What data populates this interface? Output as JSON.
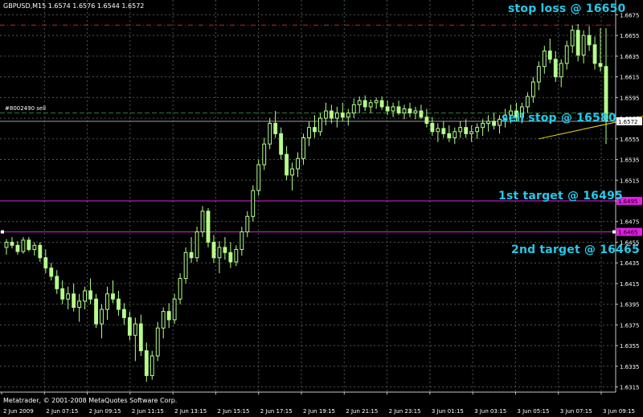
{
  "window": {
    "header": "GBPUSD,M15  1.6574 1.6576 1.6544 1.6572",
    "copyright": "Metatrader, © 2001-2008 MetaQuotes Software Corp.",
    "order_label": "#8002490 sell"
  },
  "colors": {
    "background": "#000000",
    "grid": "#4a5a4a",
    "candle": "#b6ff8c",
    "stop_loss_line": "#d22020",
    "order_line": "#2e7d32",
    "target_line": "#e020e0",
    "trendline": "#f0e010",
    "annotation": "#27c8e8"
  },
  "annotations": [
    {
      "id": "stop-loss",
      "text": "stop loss @ 16650"
    },
    {
      "id": "sell-stop",
      "text": "sell stop @ 16580"
    },
    {
      "id": "target-1",
      "text": "1st target @ 16495"
    },
    {
      "id": "target-2",
      "text": "2nd target @ 16465"
    }
  ],
  "chart_data": {
    "type": "candlestick",
    "symbol": "GBPUSD",
    "timeframe": "M15",
    "y_ticks": [
      "1.6675",
      "1.6655",
      "1.6635",
      "1.6615",
      "1.6595",
      "1.6575",
      "1.6555",
      "1.6535",
      "1.6515",
      "1.6495",
      "1.6475",
      "1.6455",
      "1.6435",
      "1.6415",
      "1.6395",
      "1.6375",
      "1.6355",
      "1.6335",
      "1.6315"
    ],
    "ylim": [
      1.631,
      1.668
    ],
    "x_ticks": [
      "2 Jun 2009",
      "2 Jun 07:15",
      "2 Jun 09:15",
      "2 Jun 11:15",
      "2 Jun 13:15",
      "2 Jun 15:15",
      "2 Jun 17:15",
      "2 Jun 19:15",
      "2 Jun 21:15",
      "2 Jun 23:15",
      "3 Jun 01:15",
      "3 Jun 03:15",
      "3 Jun 05:15",
      "3 Jun 07:15",
      "3 Jun 09:15"
    ],
    "levels": [
      {
        "name": "stop-loss-line",
        "price": 1.6665,
        "style": "dashdot"
      },
      {
        "name": "order-line",
        "price": 1.658,
        "style": "dashed"
      },
      {
        "name": "price-line",
        "price": 1.6572,
        "style": "solid"
      },
      {
        "name": "target-1-line",
        "price": 1.6495,
        "style": "solid"
      },
      {
        "name": "target-2-line",
        "price": 1.6465,
        "style": "solid"
      }
    ],
    "price_markers": [
      "1.6572",
      "1.6495",
      "1.6465"
    ],
    "trendline": {
      "from": [
        95,
        1.6555
      ],
      "to": [
        129,
        1.6595
      ]
    },
    "ohlc": [
      [
        1.645,
        1.6458,
        1.6443,
        1.6455
      ],
      [
        1.6455,
        1.646,
        1.6449,
        1.6452
      ],
      [
        1.6452,
        1.6456,
        1.6443,
        1.6446
      ],
      [
        1.6446,
        1.646,
        1.6444,
        1.6457
      ],
      [
        1.6457,
        1.646,
        1.6446,
        1.6448
      ],
      [
        1.6448,
        1.6455,
        1.6442,
        1.6452
      ],
      [
        1.6452,
        1.6455,
        1.6436,
        1.644
      ],
      [
        1.644,
        1.6448,
        1.6425,
        1.643
      ],
      [
        1.643,
        1.6435,
        1.6418,
        1.6422
      ],
      [
        1.6422,
        1.6428,
        1.6405,
        1.641
      ],
      [
        1.641,
        1.6418,
        1.6395,
        1.64
      ],
      [
        1.64,
        1.6412,
        1.639,
        1.6405
      ],
      [
        1.6405,
        1.6415,
        1.6388,
        1.6392
      ],
      [
        1.6392,
        1.6405,
        1.6378,
        1.6398
      ],
      [
        1.6398,
        1.6412,
        1.639,
        1.6408
      ],
      [
        1.6408,
        1.642,
        1.6395,
        1.64
      ],
      [
        1.64,
        1.6405,
        1.6372,
        1.6376
      ],
      [
        1.6376,
        1.6395,
        1.6362,
        1.639
      ],
      [
        1.639,
        1.6412,
        1.638,
        1.6405
      ],
      [
        1.6405,
        1.6418,
        1.6396,
        1.64
      ],
      [
        1.64,
        1.6408,
        1.6384,
        1.639
      ],
      [
        1.639,
        1.6396,
        1.6375,
        1.6382
      ],
      [
        1.6382,
        1.6388,
        1.636,
        1.6365
      ],
      [
        1.6365,
        1.6382,
        1.634,
        1.6376
      ],
      [
        1.6376,
        1.6385,
        1.6345,
        1.635
      ],
      [
        1.635,
        1.6358,
        1.632,
        1.6326
      ],
      [
        1.6326,
        1.635,
        1.6322,
        1.6345
      ],
      [
        1.6345,
        1.6378,
        1.634,
        1.6372
      ],
      [
        1.6372,
        1.6392,
        1.6362,
        1.6388
      ],
      [
        1.6388,
        1.6396,
        1.6372,
        1.638
      ],
      [
        1.638,
        1.6405,
        1.6376,
        1.64
      ],
      [
        1.64,
        1.6425,
        1.6395,
        1.642
      ],
      [
        1.642,
        1.645,
        1.6415,
        1.6445
      ],
      [
        1.6445,
        1.646,
        1.6435,
        1.644
      ],
      [
        1.644,
        1.647,
        1.6436,
        1.6465
      ],
      [
        1.6465,
        1.649,
        1.646,
        1.6485
      ],
      [
        1.6485,
        1.6488,
        1.645,
        1.6455
      ],
      [
        1.6455,
        1.6462,
        1.6435,
        1.644
      ],
      [
        1.644,
        1.6456,
        1.6425,
        1.645
      ],
      [
        1.645,
        1.646,
        1.6438,
        1.6445
      ],
      [
        1.6445,
        1.6455,
        1.643,
        1.6436
      ],
      [
        1.6436,
        1.6452,
        1.6432,
        1.6448
      ],
      [
        1.6448,
        1.647,
        1.6442,
        1.6465
      ],
      [
        1.6465,
        1.6485,
        1.646,
        1.648
      ],
      [
        1.648,
        1.651,
        1.6475,
        1.6505
      ],
      [
        1.6505,
        1.6535,
        1.65,
        1.653
      ],
      [
        1.653,
        1.6556,
        1.6525,
        1.655
      ],
      [
        1.655,
        1.6575,
        1.6545,
        1.657
      ],
      [
        1.657,
        1.6582,
        1.6556,
        1.656
      ],
      [
        1.656,
        1.6566,
        1.6535,
        1.654
      ],
      [
        1.654,
        1.6548,
        1.6515,
        1.652
      ],
      [
        1.652,
        1.6532,
        1.6505,
        1.6526
      ],
      [
        1.6526,
        1.6542,
        1.6518,
        1.6536
      ],
      [
        1.6536,
        1.656,
        1.653,
        1.6556
      ],
      [
        1.6556,
        1.6572,
        1.6548,
        1.6566
      ],
      [
        1.6566,
        1.6578,
        1.6556,
        1.6562
      ],
      [
        1.6562,
        1.658,
        1.6558,
        1.6575
      ],
      [
        1.6575,
        1.659,
        1.6568,
        1.6582
      ],
      [
        1.6582,
        1.6588,
        1.657,
        1.6575
      ],
      [
        1.6575,
        1.6586,
        1.6566,
        1.658
      ],
      [
        1.658,
        1.659,
        1.6572,
        1.6576
      ],
      [
        1.6576,
        1.6584,
        1.6568,
        1.658
      ],
      [
        1.658,
        1.6594,
        1.6575,
        1.6588
      ],
      [
        1.6588,
        1.6596,
        1.658,
        1.6592
      ],
      [
        1.6592,
        1.6597,
        1.6582,
        1.6586
      ],
      [
        1.6586,
        1.6593,
        1.658,
        1.659
      ],
      [
        1.659,
        1.6595,
        1.6584,
        1.6592
      ],
      [
        1.6592,
        1.6596,
        1.6583,
        1.6586
      ],
      [
        1.6586,
        1.6592,
        1.6578,
        1.6582
      ],
      [
        1.6582,
        1.659,
        1.6576,
        1.6586
      ],
      [
        1.6586,
        1.6592,
        1.6578,
        1.658
      ],
      [
        1.658,
        1.6588,
        1.6574,
        1.6584
      ],
      [
        1.6584,
        1.659,
        1.6576,
        1.658
      ],
      [
        1.658,
        1.6586,
        1.6574,
        1.6582
      ],
      [
        1.6582,
        1.6588,
        1.6574,
        1.6576
      ],
      [
        1.6576,
        1.6584,
        1.6566,
        1.657
      ],
      [
        1.657,
        1.6576,
        1.6558,
        1.6562
      ],
      [
        1.6562,
        1.657,
        1.6552,
        1.6565
      ],
      [
        1.6565,
        1.6572,
        1.6556,
        1.656
      ],
      [
        1.656,
        1.6568,
        1.6552,
        1.6556
      ],
      [
        1.6556,
        1.6566,
        1.655,
        1.6562
      ],
      [
        1.6562,
        1.6572,
        1.6556,
        1.6566
      ],
      [
        1.6566,
        1.6574,
        1.6556,
        1.656
      ],
      [
        1.656,
        1.6568,
        1.6552,
        1.6562
      ],
      [
        1.6562,
        1.657,
        1.6555,
        1.6566
      ],
      [
        1.6566,
        1.6574,
        1.6558,
        1.657
      ],
      [
        1.657,
        1.6578,
        1.6562,
        1.6572
      ],
      [
        1.6572,
        1.658,
        1.6564,
        1.6568
      ],
      [
        1.6568,
        1.6578,
        1.656,
        1.6574
      ],
      [
        1.6574,
        1.6584,
        1.6566,
        1.6578
      ],
      [
        1.6578,
        1.6588,
        1.657,
        1.6582
      ],
      [
        1.6582,
        1.659,
        1.6572,
        1.6576
      ],
      [
        1.6576,
        1.659,
        1.657,
        1.6586
      ],
      [
        1.6586,
        1.66,
        1.658,
        1.6596
      ],
      [
        1.6596,
        1.6615,
        1.659,
        1.661
      ],
      [
        1.661,
        1.663,
        1.6602,
        1.6625
      ],
      [
        1.6625,
        1.6645,
        1.6618,
        1.664
      ],
      [
        1.664,
        1.6652,
        1.6628,
        1.6632
      ],
      [
        1.6632,
        1.664,
        1.661,
        1.6615
      ],
      [
        1.6615,
        1.6632,
        1.6605,
        1.6628
      ],
      [
        1.6628,
        1.665,
        1.6622,
        1.6645
      ],
      [
        1.6645,
        1.6665,
        1.6638,
        1.666
      ],
      [
        1.666,
        1.6666,
        1.663,
        1.6636
      ],
      [
        1.6636,
        1.666,
        1.6628,
        1.6655
      ],
      [
        1.6655,
        1.6664,
        1.664,
        1.6646
      ],
      [
        1.6646,
        1.6654,
        1.6622,
        1.6628
      ],
      [
        1.6628,
        1.6662,
        1.662,
        1.6625
      ],
      [
        1.6625,
        1.6662,
        1.655,
        1.6572
      ]
    ]
  }
}
